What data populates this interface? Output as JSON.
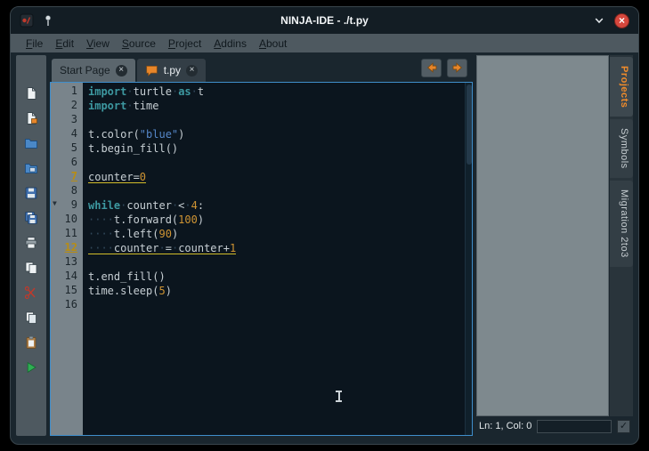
{
  "window": {
    "title": "NINJA-IDE - ./t.py"
  },
  "menubar": {
    "items": [
      "File",
      "Edit",
      "View",
      "Source",
      "Project",
      "Addins",
      "About"
    ]
  },
  "tabbar": {
    "tabs": [
      {
        "label": "Start Page",
        "active": false,
        "icon": null
      },
      {
        "label": "t.py",
        "active": true,
        "icon": "message"
      }
    ]
  },
  "toolbar": {
    "buttons": [
      "new-file",
      "new-project",
      "open-file",
      "open-project",
      "save-file",
      "save-project",
      "print-file",
      "copy-document",
      "cut",
      "copy",
      "paste",
      "run-project"
    ]
  },
  "editor": {
    "lines": [
      {
        "n": "1",
        "warn": false,
        "fold": false,
        "segs": [
          [
            "kw",
            "import"
          ],
          [
            "ws",
            "·"
          ],
          [
            "pl",
            "turtle"
          ],
          [
            "ws",
            "·"
          ],
          [
            "kw",
            "as"
          ],
          [
            "ws",
            "·"
          ],
          [
            "pl",
            "t"
          ]
        ]
      },
      {
        "n": "2",
        "warn": false,
        "fold": false,
        "segs": [
          [
            "kw",
            "import"
          ],
          [
            "ws",
            "·"
          ],
          [
            "pl",
            "time"
          ]
        ]
      },
      {
        "n": "3",
        "warn": false,
        "fold": false,
        "segs": []
      },
      {
        "n": "4",
        "warn": false,
        "fold": false,
        "segs": [
          [
            "pl",
            "t.color("
          ],
          [
            "str",
            "\"blue\""
          ],
          [
            "pl",
            ")"
          ]
        ]
      },
      {
        "n": "5",
        "warn": false,
        "fold": false,
        "segs": [
          [
            "pl",
            "t.begin_fill()"
          ]
        ]
      },
      {
        "n": "6",
        "warn": false,
        "fold": false,
        "segs": []
      },
      {
        "n": "7",
        "warn": true,
        "fold": false,
        "segs": [
          [
            "pl",
            "counter="
          ],
          [
            "num",
            "0"
          ]
        ]
      },
      {
        "n": "8",
        "warn": false,
        "fold": false,
        "segs": []
      },
      {
        "n": "9",
        "warn": false,
        "fold": true,
        "segs": [
          [
            "kw",
            "while"
          ],
          [
            "ws",
            "·"
          ],
          [
            "pl",
            "counter"
          ],
          [
            "ws",
            "·"
          ],
          [
            "pl",
            "<"
          ],
          [
            "ws",
            "·"
          ],
          [
            "num",
            "4"
          ],
          [
            "pl",
            ":"
          ]
        ]
      },
      {
        "n": "10",
        "warn": false,
        "fold": false,
        "segs": [
          [
            "ws",
            "····"
          ],
          [
            "pl",
            "t.forward("
          ],
          [
            "num",
            "100"
          ],
          [
            "pl",
            ")"
          ]
        ]
      },
      {
        "n": "11",
        "warn": false,
        "fold": false,
        "segs": [
          [
            "ws",
            "····"
          ],
          [
            "pl",
            "t.left("
          ],
          [
            "num",
            "90"
          ],
          [
            "pl",
            ")"
          ]
        ]
      },
      {
        "n": "12",
        "warn": true,
        "fold": false,
        "segs": [
          [
            "ws",
            "····"
          ],
          [
            "pl",
            "counter"
          ],
          [
            "ws",
            "·"
          ],
          [
            "pl",
            "="
          ],
          [
            "ws",
            "·"
          ],
          [
            "pl",
            "counter+"
          ],
          [
            "num",
            "1"
          ]
        ]
      },
      {
        "n": "13",
        "warn": false,
        "fold": false,
        "segs": []
      },
      {
        "n": "14",
        "warn": false,
        "fold": false,
        "segs": [
          [
            "pl",
            "t.end_fill()"
          ]
        ]
      },
      {
        "n": "15",
        "warn": false,
        "fold": false,
        "segs": [
          [
            "pl",
            "time.sleep("
          ],
          [
            "num",
            "5"
          ],
          [
            "pl",
            ")"
          ]
        ]
      },
      {
        "n": "16",
        "warn": false,
        "fold": false,
        "segs": []
      }
    ]
  },
  "side_tabs": [
    {
      "label": "Projects",
      "active": true
    },
    {
      "label": "Symbols",
      "active": false
    },
    {
      "label": "Migration 2to3",
      "active": false
    }
  ],
  "statusbar": {
    "position": "Ln: 1, Col: 0",
    "goto_value": ""
  },
  "colors": {
    "accent_orange": "#e8862a",
    "keyword_teal": "#3d98a0",
    "string_blue": "#5587c9",
    "number_orange": "#cf9433",
    "warning_yellow": "#d3bd2a",
    "run_green": "#2fae53",
    "close_red": "#d6473d"
  }
}
